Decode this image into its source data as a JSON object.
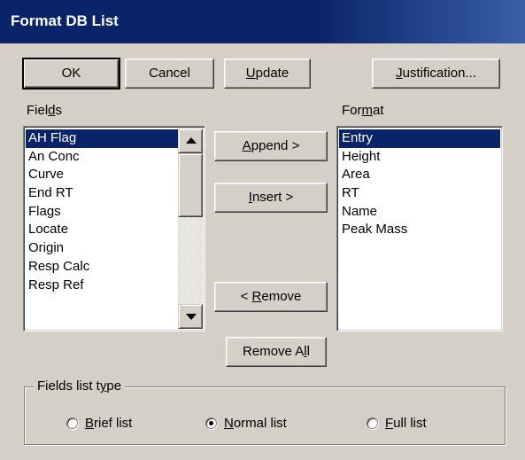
{
  "window": {
    "title": "Format DB List"
  },
  "toolbar": {
    "ok": "OK",
    "cancel": "Cancel",
    "update": {
      "mnemonic": "U",
      "rest": "pdate"
    },
    "justification": {
      "mnemonic": "J",
      "rest": "ustification..."
    }
  },
  "fields": {
    "label": {
      "before": "Fiel",
      "mnemonic": "d",
      "after": "s"
    },
    "items": [
      "AH Flag",
      "An Conc",
      "Curve",
      "End RT",
      "Flags",
      "Locate",
      "Origin",
      "Resp Calc",
      "Resp Ref"
    ],
    "selected": "AH Flag"
  },
  "format": {
    "label": {
      "before": "For",
      "mnemonic": "m",
      "after": "at"
    },
    "items": [
      "Entry",
      "Height",
      "Area",
      "RT",
      "Name",
      "Peak Mass"
    ],
    "selected": "Entry"
  },
  "actions": {
    "append": {
      "mnemonic": "A",
      "rest": "ppend >"
    },
    "insert": {
      "mnemonic": "I",
      "rest": "nsert >"
    },
    "remove": {
      "before": "< ",
      "mnemonic": "R",
      "rest": "emove"
    },
    "remove_all": {
      "before": "Remove A",
      "mnemonic": "l",
      "rest": "l"
    }
  },
  "fields_list_type": {
    "legend": {
      "before": "Fields list t",
      "mnemonic": "y",
      "after": "pe"
    },
    "options": [
      {
        "mnemonic": "B",
        "rest": "rief list",
        "checked": false
      },
      {
        "mnemonic": "N",
        "rest": "ormal list",
        "checked": true
      },
      {
        "mnemonic": "F",
        "rest": "ull list",
        "checked": false
      }
    ]
  },
  "colors": {
    "title_bar": "#0a246a",
    "selection": "#0a246a",
    "face": "#d4d0c8"
  }
}
